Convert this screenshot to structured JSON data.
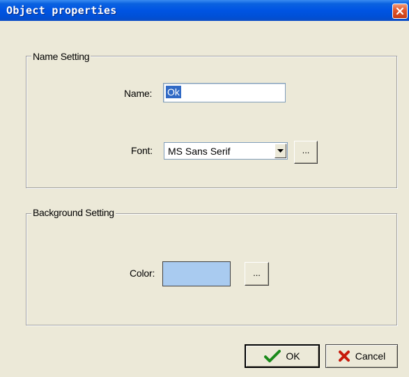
{
  "window": {
    "title": "Object properties",
    "close_icon": "close-icon"
  },
  "name_setting": {
    "group_label": "Name Setting",
    "name_label": "Name:",
    "name_value": "Ok",
    "font_label": "Font:",
    "font_value": "MS Sans Serif",
    "font_button_label": "..."
  },
  "background_setting": {
    "group_label": "Background Setting",
    "color_label": "Color:",
    "color_value": "#a9cbf0",
    "color_button_label": "..."
  },
  "buttons": {
    "ok_label": "OK",
    "ok_icon": "checkmark-icon",
    "cancel_label": "Cancel",
    "cancel_icon": "x-mark-icon"
  },
  "colors": {
    "titlebar": "#0054e3",
    "dialog_background": "#ece9d8",
    "selection": "#316ac5",
    "close_button": "#e2582e"
  }
}
